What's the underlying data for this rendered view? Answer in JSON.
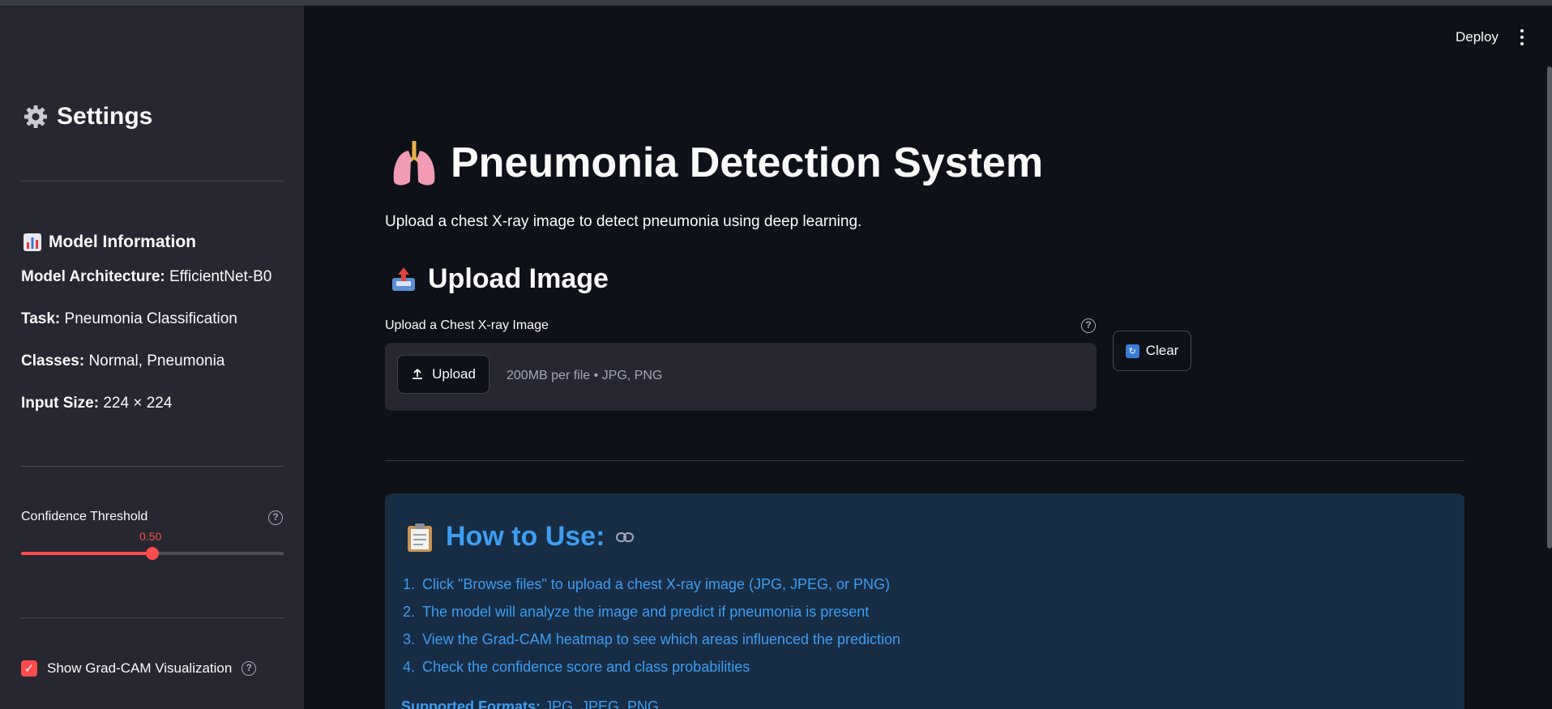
{
  "header": {
    "deploy_label": "Deploy"
  },
  "sidebar": {
    "title": "Settings",
    "model_info": {
      "heading": "Model Information",
      "items": [
        {
          "label": "Model Architecture:",
          "value": "EfficientNet-B0"
        },
        {
          "label": "Task:",
          "value": "Pneumonia Classification"
        },
        {
          "label": "Classes:",
          "value": "Normal, Pneumonia"
        },
        {
          "label": "Input Size:",
          "value": "224 × 224"
        }
      ]
    },
    "slider": {
      "label": "Confidence Threshold",
      "value_text": "0.50",
      "value": 0.5,
      "min": 0,
      "max": 1
    },
    "checkbox": {
      "label": "Show Grad-CAM Visualization",
      "checked": true
    }
  },
  "main": {
    "title": "Pneumonia Detection System",
    "subtitle": "Upload a chest X-ray image to detect pneumonia using deep learning.",
    "upload_section": {
      "heading": "Upload Image",
      "label": "Upload a Chest X-ray Image",
      "button_label": "Upload",
      "hint": "200MB per file • JPG, PNG",
      "clear_label": "Clear"
    },
    "how_to": {
      "heading": "How to Use:",
      "steps": [
        {
          "num": "1.",
          "text": "Click \"Browse files\" to upload a chest X-ray image (JPG, JPEG, or PNG)"
        },
        {
          "num": "2.",
          "text": "The model will analyze the image and predict if pneumonia is present"
        },
        {
          "num": "3.",
          "text": "View the Grad-CAM heatmap to see which areas influenced the prediction"
        },
        {
          "num": "4.",
          "text": "Check the confidence score and class probabilities"
        }
      ],
      "formats_label": "Supported Formats:",
      "formats_value": "JPG, JPEG, PNG"
    }
  },
  "colors": {
    "accent": "#ff4b4b",
    "info_text": "#3d9df3",
    "info_bg": "#172d43",
    "sidebar_bg": "#262730",
    "main_bg": "#0e1117"
  }
}
